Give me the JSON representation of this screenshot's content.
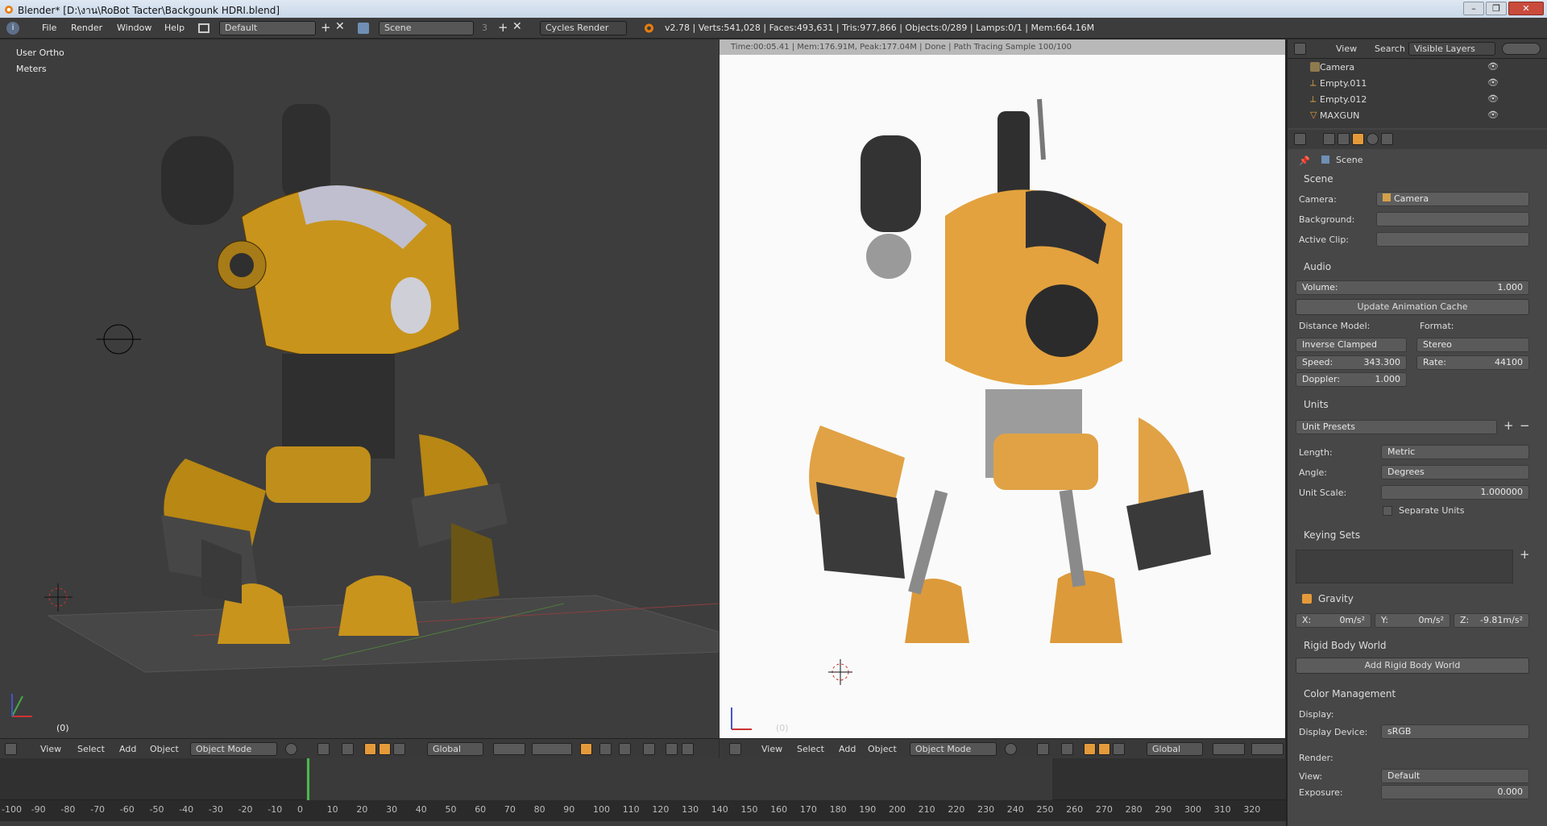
{
  "window": {
    "title": "Blender* [D:\\งาน\\RoBot Tacter\\Backgounk HDRI.blend]",
    "controls": [
      "–",
      "❐",
      "✕"
    ]
  },
  "infobar": {
    "menus": [
      "File",
      "Render",
      "Window",
      "Help"
    ],
    "layout": "Default",
    "scene": "Scene",
    "scene_users": "3",
    "engine": "Cycles Render",
    "stats": "v2.78 | Verts:541,028 | Faces:493,631 | Tris:977,866 | Objects:0/289 | Lamps:0/1 | Mem:664.16M"
  },
  "viewport_left": {
    "view_name": "User Ortho",
    "units": "Meters",
    "frame": "(0)"
  },
  "viewport_right": {
    "render_info": "Time:00:05.41 | Mem:176.91M, Peak:177.04M | Done | Path Tracing Sample 100/100",
    "frame": "(0)"
  },
  "viewport_header": {
    "menus": [
      "View",
      "Select",
      "Add",
      "Object"
    ],
    "mode": "Object Mode",
    "orientation": "Global"
  },
  "timeline": {
    "ticks": [
      "-100",
      "-90",
      "-80",
      "-70",
      "-60",
      "-50",
      "-40",
      "-30",
      "-20",
      "-10",
      "0",
      "10",
      "20",
      "30",
      "40",
      "50",
      "60",
      "70",
      "80",
      "90",
      "100",
      "110",
      "120",
      "130",
      "140",
      "150",
      "160",
      "170",
      "180",
      "190",
      "200",
      "210",
      "220",
      "230",
      "240",
      "250",
      "260",
      "270",
      "280",
      "290",
      "300",
      "310",
      "320"
    ],
    "current_frame": 0
  },
  "outliner": {
    "menus": [
      "View",
      "Search"
    ],
    "filter": "Visible Layers",
    "items": [
      "Camera",
      "Empty.011",
      "Empty.012",
      "MAXGUN"
    ]
  },
  "properties": {
    "context": "Scene",
    "scene_panel": {
      "title": "Scene",
      "camera_label": "Camera:",
      "camera_value": "Camera",
      "background_label": "Background:",
      "active_clip_label": "Active Clip:"
    },
    "audio_panel": {
      "title": "Audio",
      "volume_label": "Volume:",
      "volume_value": "1.000",
      "update_cache": "Update Animation Cache",
      "distance_model_label": "Distance Model:",
      "distance_model": "Inverse Clamped",
      "format_label": "Format:",
      "format": "Stereo",
      "speed_label": "Speed:",
      "speed": "343.300",
      "rate_label": "Rate:",
      "rate": "44100",
      "doppler_label": "Doppler:",
      "doppler": "1.000"
    },
    "units_panel": {
      "title": "Units",
      "presets": "Unit Presets",
      "length_label": "Length:",
      "length": "Metric",
      "angle_label": "Angle:",
      "angle": "Degrees",
      "scale_label": "Unit Scale:",
      "scale": "1.000000",
      "separate": "Separate Units"
    },
    "keying_panel": {
      "title": "Keying Sets"
    },
    "gravity_panel": {
      "title": "Gravity",
      "x_label": "X:",
      "x": "0m/s²",
      "y_label": "Y:",
      "y": "0m/s²",
      "z_label": "Z:",
      "z": "-9.81m/s²"
    },
    "rigid_panel": {
      "title": "Rigid Body World",
      "add": "Add Rigid Body World"
    },
    "color_panel": {
      "title": "Color Management",
      "display_label": "Display:",
      "device_label": "Display Device:",
      "device": "sRGB",
      "render_label": "Render:",
      "view_label": "View:",
      "view": "Default",
      "exposure_label": "Exposure:",
      "exposure": "0.000"
    }
  }
}
